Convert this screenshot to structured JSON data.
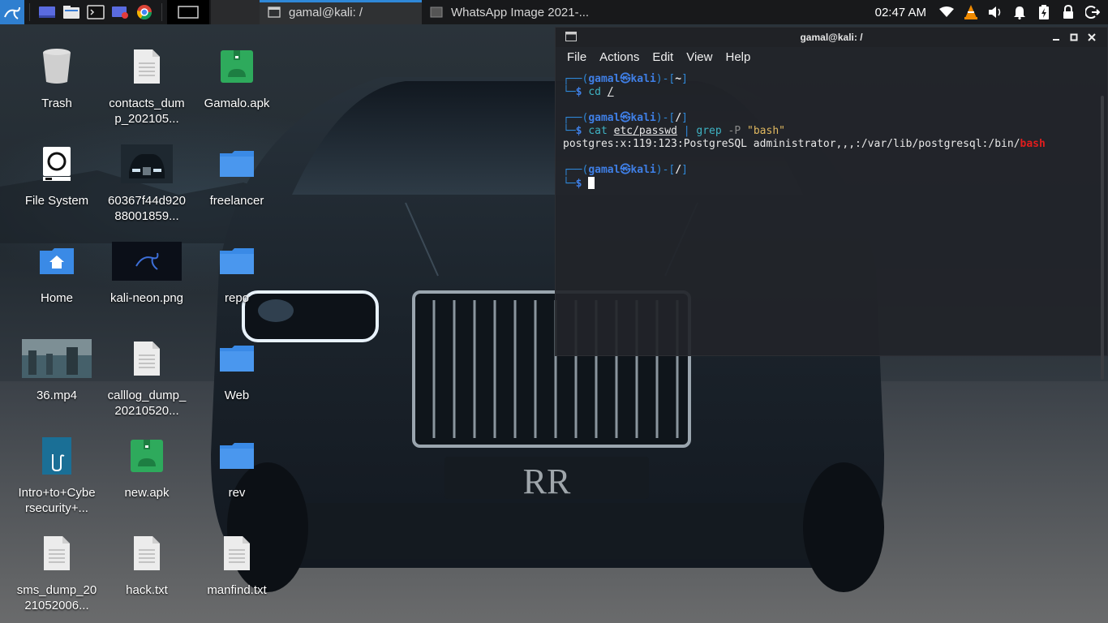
{
  "panel": {
    "tasks": [
      {
        "label": "gamal@kali: /",
        "active": true
      },
      {
        "label": "WhatsApp Image 2021-...",
        "active": false
      }
    ],
    "clock": "02:47 AM"
  },
  "desktop": {
    "icons": [
      {
        "label": "Trash"
      },
      {
        "label": "contacts_dump_202105..."
      },
      {
        "label": "Gamalo.apk"
      },
      {
        "label": "File System"
      },
      {
        "label": "60367f44d92088001859..."
      },
      {
        "label": "freelancer"
      },
      {
        "label": "Home"
      },
      {
        "label": "kali-neon.png"
      },
      {
        "label": "repo"
      },
      {
        "label": "36.mp4"
      },
      {
        "label": "calllog_dump_20210520..."
      },
      {
        "label": "Web"
      },
      {
        "label": "Intro+to+Cybersecurity+..."
      },
      {
        "label": "new.apk"
      },
      {
        "label": "rev"
      },
      {
        "label": "sms_dump_2021052006..."
      },
      {
        "label": "hack.txt"
      },
      {
        "label": "manfind.txt"
      }
    ]
  },
  "terminal": {
    "title": "gamal@kali: /",
    "menu": [
      "File",
      "Actions",
      "Edit",
      "View",
      "Help"
    ],
    "user": "gamal",
    "host": "kali",
    "dir_home": "~",
    "dir_root": "/",
    "cmd1": "cd",
    "cmd1_arg": "/",
    "cmd2_cat": "cat",
    "cmd2_file": "etc/passwd",
    "cmd2_pipe": "|",
    "cmd2_grep": "grep",
    "cmd2_flag": "-P",
    "cmd2_pattern": "\"bash\"",
    "output_prefix": "postgres:x:119:123:PostgreSQL administrator,,,:/var/lib/postgresql:/bin/",
    "output_match": "bash"
  },
  "colors": {
    "accent": "#2f88d8",
    "prompt_user": "#3f7fe6",
    "match": "#e11d1d"
  }
}
